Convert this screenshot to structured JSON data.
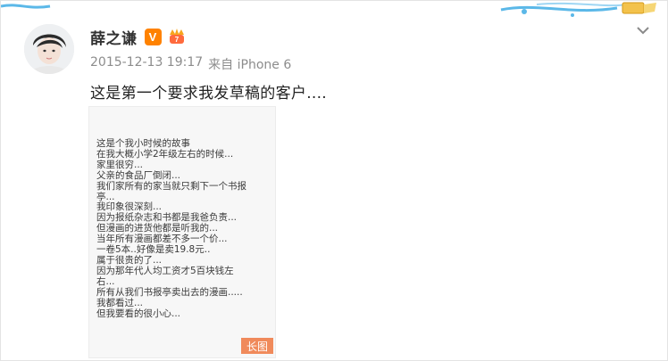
{
  "post": {
    "username": "薛之谦",
    "verified_badge": "V",
    "timestamp": "2015-12-13 19:17",
    "source": "来自 iPhone 6",
    "text": "这是第一个要求我发草稿的客户....",
    "image": {
      "badge": "长图",
      "lines": [
        "这是个我小时候的故事",
        "在我大概小学2年级左右的时候...",
        "家里很穷...",
        "父亲的食品厂倒闭...",
        "我们家所有的家当就只剩下一个书报",
        "亭...",
        "我印象很深刻...",
        "因为报纸杂志和书都是我爸负责...",
        "但漫画的进货他都是听我的...",
        "当年所有漫画都差不多一个价...",
        "一卷5本..好像是卖19.8元..",
        "属于很贵的了...",
        "因为那年代人均工资才5百块钱左",
        "右...",
        "所有从我们书报亭卖出去的漫画.....",
        "我都看过...",
        "但我要看的很小心..."
      ]
    }
  },
  "colors": {
    "accent_orange": "#ff8200",
    "long_badge": "#f08a5b",
    "meta_gray": "#8c8c8c"
  },
  "icons": {
    "verified": "verified-v-icon",
    "level": "vip-level-icon",
    "menu": "chevron-down-icon"
  }
}
